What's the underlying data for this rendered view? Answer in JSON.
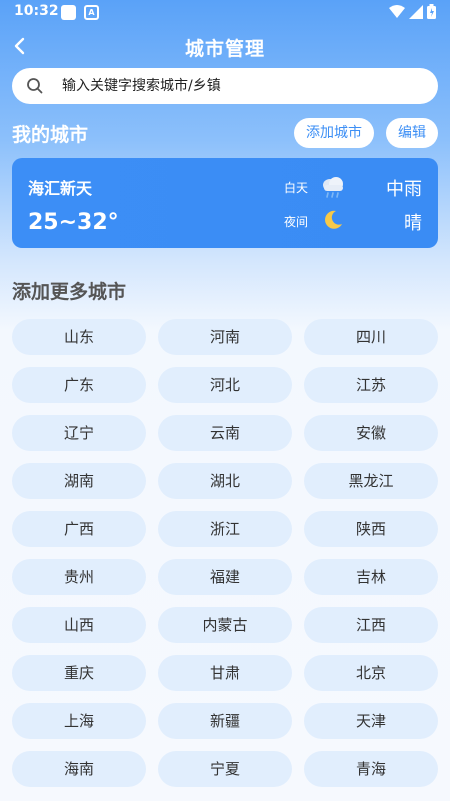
{
  "status_bar": {
    "time": "10:32"
  },
  "nav": {
    "title": "城市管理"
  },
  "search": {
    "placeholder": "输入关键字搜索城市/乡镇"
  },
  "my_cities": {
    "title": "我的城市",
    "add_button": "添加城市",
    "edit_button": "编辑",
    "card": {
      "city": "海汇新天",
      "temp_range": "25~32°",
      "day_label": "白天",
      "day_weather": "中雨",
      "day_icon": "rain-cloud-icon",
      "night_label": "夜间",
      "night_weather": "晴",
      "night_icon": "moon-icon"
    }
  },
  "more_cities": {
    "title": "添加更多城市",
    "items": [
      "山东",
      "河南",
      "四川",
      "广东",
      "河北",
      "江苏",
      "辽宁",
      "云南",
      "安徽",
      "湖南",
      "湖北",
      "黑龙江",
      "广西",
      "浙江",
      "陕西",
      "贵州",
      "福建",
      "吉林",
      "山西",
      "内蒙古",
      "江西",
      "重庆",
      "甘肃",
      "北京",
      "上海",
      "新疆",
      "天津",
      "海南",
      "宁夏",
      "青海"
    ]
  },
  "colors": {
    "accent": "#3d8ff5",
    "chip_bg": "#e1eefd"
  }
}
